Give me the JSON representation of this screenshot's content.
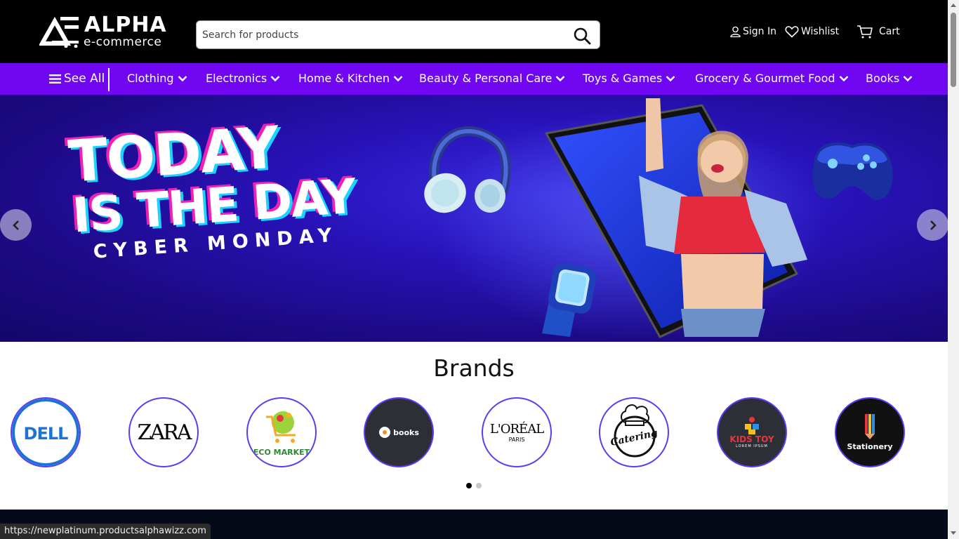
{
  "header": {
    "logo_name": "ALPHA",
    "logo_sub": "e-commerce",
    "search_placeholder": "Search for products",
    "sign_in": "Sign In",
    "wishlist": "Wishlist",
    "cart": "Cart"
  },
  "nav": {
    "see_all": "See All",
    "items": [
      {
        "label": "Clothing"
      },
      {
        "label": "Electronics"
      },
      {
        "label": "Home & Kitchen"
      },
      {
        "label": "Beauty & Personal Care"
      },
      {
        "label": "Toys & Games"
      },
      {
        "label": "Grocery & Gourmet Food"
      },
      {
        "label": "Books"
      }
    ]
  },
  "hero": {
    "line1": "TODAY",
    "line2": "IS THE DAY",
    "line3": "CYBER MONDAY"
  },
  "brands": {
    "title": "Brands",
    "items": [
      {
        "name": "DELL"
      },
      {
        "name": "ZARA"
      },
      {
        "name": "ECO MARKET"
      },
      {
        "name": "books"
      },
      {
        "name": "L'ORÉAL",
        "sub": "PARIS"
      },
      {
        "name": "Catering"
      },
      {
        "name": "KIDS TOY",
        "sub": "LOREM IPSUM"
      },
      {
        "name": "Stationery"
      }
    ],
    "active_page": 1,
    "page_count": 2
  },
  "status": {
    "url": "https://newplatinum.productsalphawizz.com"
  },
  "colors": {
    "header_bg": "#000000",
    "nav_bg": "#7107f2",
    "brand_ring": "#5b3cf0"
  }
}
